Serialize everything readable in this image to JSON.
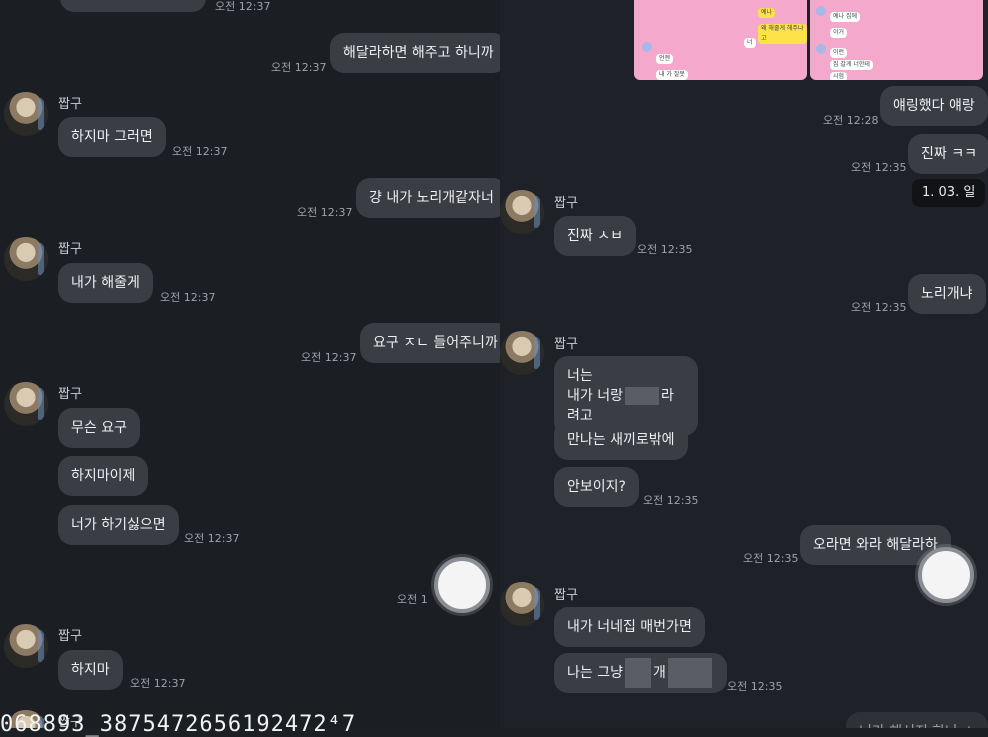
{
  "left": {
    "sender": "짭구",
    "msgs": [
      {
        "text": "해달라하면 해주고 하니까",
        "time": "오전 12:37"
      },
      {
        "text": "하지마 그러면",
        "time": "오전 12:37"
      },
      {
        "text": "걍 내가 노리개같자너",
        "time": "오전 12:37"
      },
      {
        "text": "내가 해줄게",
        "time": "오전 12:37"
      },
      {
        "text": "요구 ㅈㄴ 들어주니까",
        "time": "오전 12:37"
      },
      {
        "text": "무슨 요구"
      },
      {
        "text": "하지마이제"
      },
      {
        "text": "너가 하기싫으면",
        "time": "오전 12:37"
      },
      {
        "text": "하지마",
        "time": "오전 12:37"
      }
    ],
    "partial_time": "오전 1",
    "top_time": "오전 12:37"
  },
  "right": {
    "sender": "짭구",
    "thumb_texts": {
      "a": "예나",
      "b": "왜 해줄게 해주냐고",
      "c": "너 ",
      "d": "예나 집에",
      "e": "이거",
      "f": "언젠",
      "g": "내 가 잘못",
      "h": "이런",
      "i": "집 갈게 너한테",
      "j": "시험 "
    },
    "msgs": [
      {
        "text": "얘링했다 얘랑",
        "time": "오전 12:28"
      },
      {
        "text": "진짜 ㅋㅋ",
        "time": "오전 12:35"
      },
      {
        "text": "진짜 ㅅㅂ",
        "time": "오전 12:35"
      },
      {
        "text": "노리개냐",
        "time": "오전 12:35"
      },
      {
        "line1": "너는",
        "line2a": "내가 너랑",
        "line2b": "라려고"
      },
      {
        "text": "만나는 새끼로밖에"
      },
      {
        "text": "안보이지?",
        "time": "오전 12:35"
      },
      {
        "text": "오라면 와라 해달라하",
        "time": "오전 12:35"
      },
      {
        "text": "내가 너네집 매번가면"
      },
      {
        "text_a": "나는 그냥",
        "text_b": "개",
        "time": "오전 12:35"
      }
    ],
    "date_chip": "1. 03. 일",
    "cut_bottom_text": "너가 해서지 하나 ㅎ"
  },
  "caption": "068893_3875472656192472⁴7"
}
